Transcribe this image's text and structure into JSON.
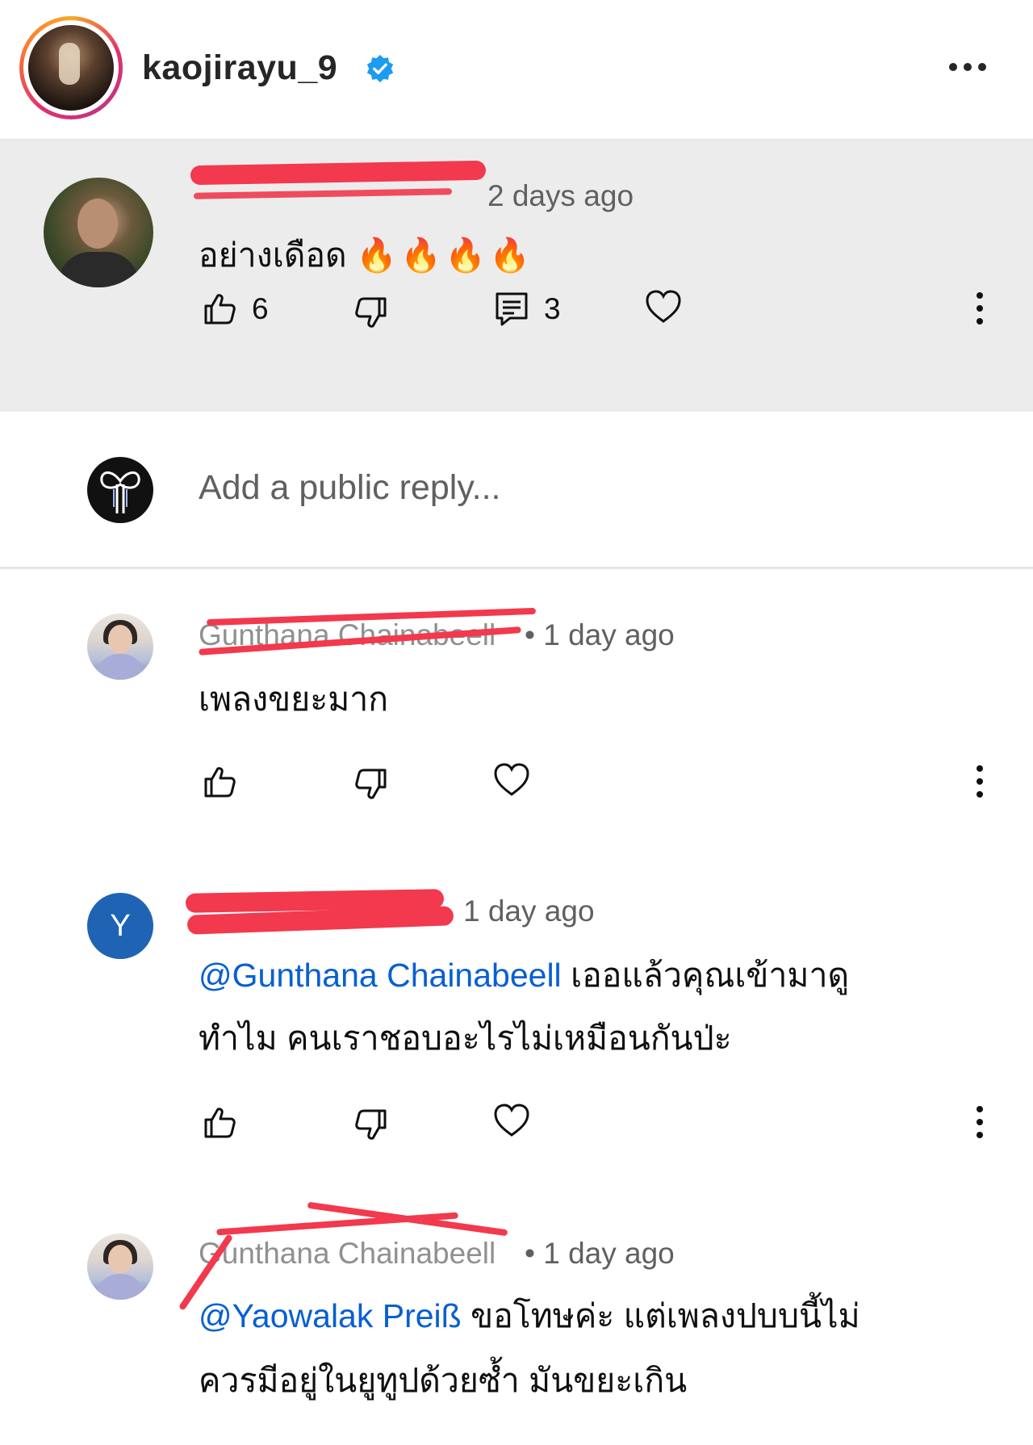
{
  "profile": {
    "username": "kaojirayu_9"
  },
  "top_comment": {
    "time": "2 days ago",
    "text": "อย่างเดือด",
    "emojis": "🔥🔥🔥🔥",
    "likes": "6",
    "replies": "3"
  },
  "reply_box": {
    "placeholder": "Add a public reply..."
  },
  "replies": [
    {
      "author": "Gunthana Chainabeell",
      "sep_time": "• 1 day ago",
      "text": "เพลงขยะมาก",
      "avatar_type": "photo"
    },
    {
      "author": "",
      "time": "1 day ago",
      "mention": "@Gunthana Chainabeell",
      "text_line1": " เออแล้วคุณเข้ามาดู",
      "text_line2": "ทำไม คนเราชอบอะไรไม่เหมือนกันป่ะ",
      "avatar_letter": "Y"
    },
    {
      "author": "Gunthana Chainabeell",
      "sep_time": "• 1 day ago",
      "mention": "@Yaowalak Preiß",
      "text_line1": " ขอโทษค่ะ แต่เพลงปบบนี้ไม่",
      "text_line2": "ควรมีอยู่ในยูทูปด้วยซ้ำ มันขยะเกิน",
      "avatar_type": "photo"
    }
  ],
  "icons": [
    "verified-badge-icon",
    "more-horizontal-icon",
    "thumbs-up-icon",
    "thumbs-down-icon",
    "reply-icon",
    "heart-icon",
    "more-vertical-icon"
  ],
  "colors": {
    "mention": "#065fd4",
    "highlight_bg": "#ececec",
    "redaction": "#f2394d",
    "verified": "#1d9bf0"
  }
}
